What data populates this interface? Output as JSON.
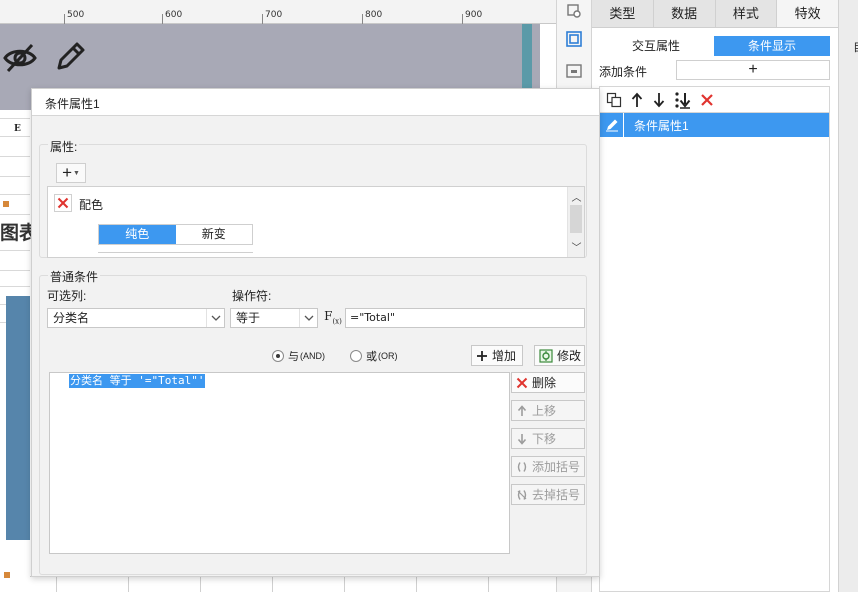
{
  "ruler": {
    "ticks": [
      "500",
      "600",
      "700",
      "800",
      "900"
    ]
  },
  "canvas": {
    "column_e": "E",
    "chart_text": "图表"
  },
  "panel": {
    "tabs": [
      {
        "label": "类型"
      },
      {
        "label": "数据"
      },
      {
        "label": "样式"
      },
      {
        "label": "特效"
      }
    ],
    "subtabs": [
      {
        "label": "交互属性"
      },
      {
        "label": "条件显示"
      }
    ],
    "add_condition_label": "添加条件",
    "add_condition_symbol": "+",
    "condition_items": [
      {
        "label": "条件属性1"
      }
    ]
  },
  "edge": {
    "char": "自"
  },
  "dialog": {
    "title": "条件属性1",
    "attributes_label": "属性:",
    "attribute_name": "配色",
    "color_segments": [
      "纯色",
      "新变"
    ],
    "general_conditions_label": "普通条件",
    "column_label": "可选列:",
    "column_value": "分类名",
    "operator_label": "操作符:",
    "operator_value": "等于",
    "formula_value": "=\"Total\"",
    "radio_and": "与",
    "radio_and_sub": "(AND)",
    "radio_or": "或",
    "radio_or_sub": "(OR)",
    "add_button": "增加",
    "modify_button": "修改",
    "result_line": "分类名 等于 '=\"Total\"'",
    "side_buttons": {
      "delete": "删除",
      "move_up": "上移",
      "move_down": "下移",
      "add_bracket": "添加括号",
      "remove_bracket": "去掉括号"
    }
  },
  "colors": {
    "accent": "#3d98f0",
    "delete_red": "#e0342f",
    "banner": "#a8a9b6",
    "bar_blue": "#5685ab"
  }
}
